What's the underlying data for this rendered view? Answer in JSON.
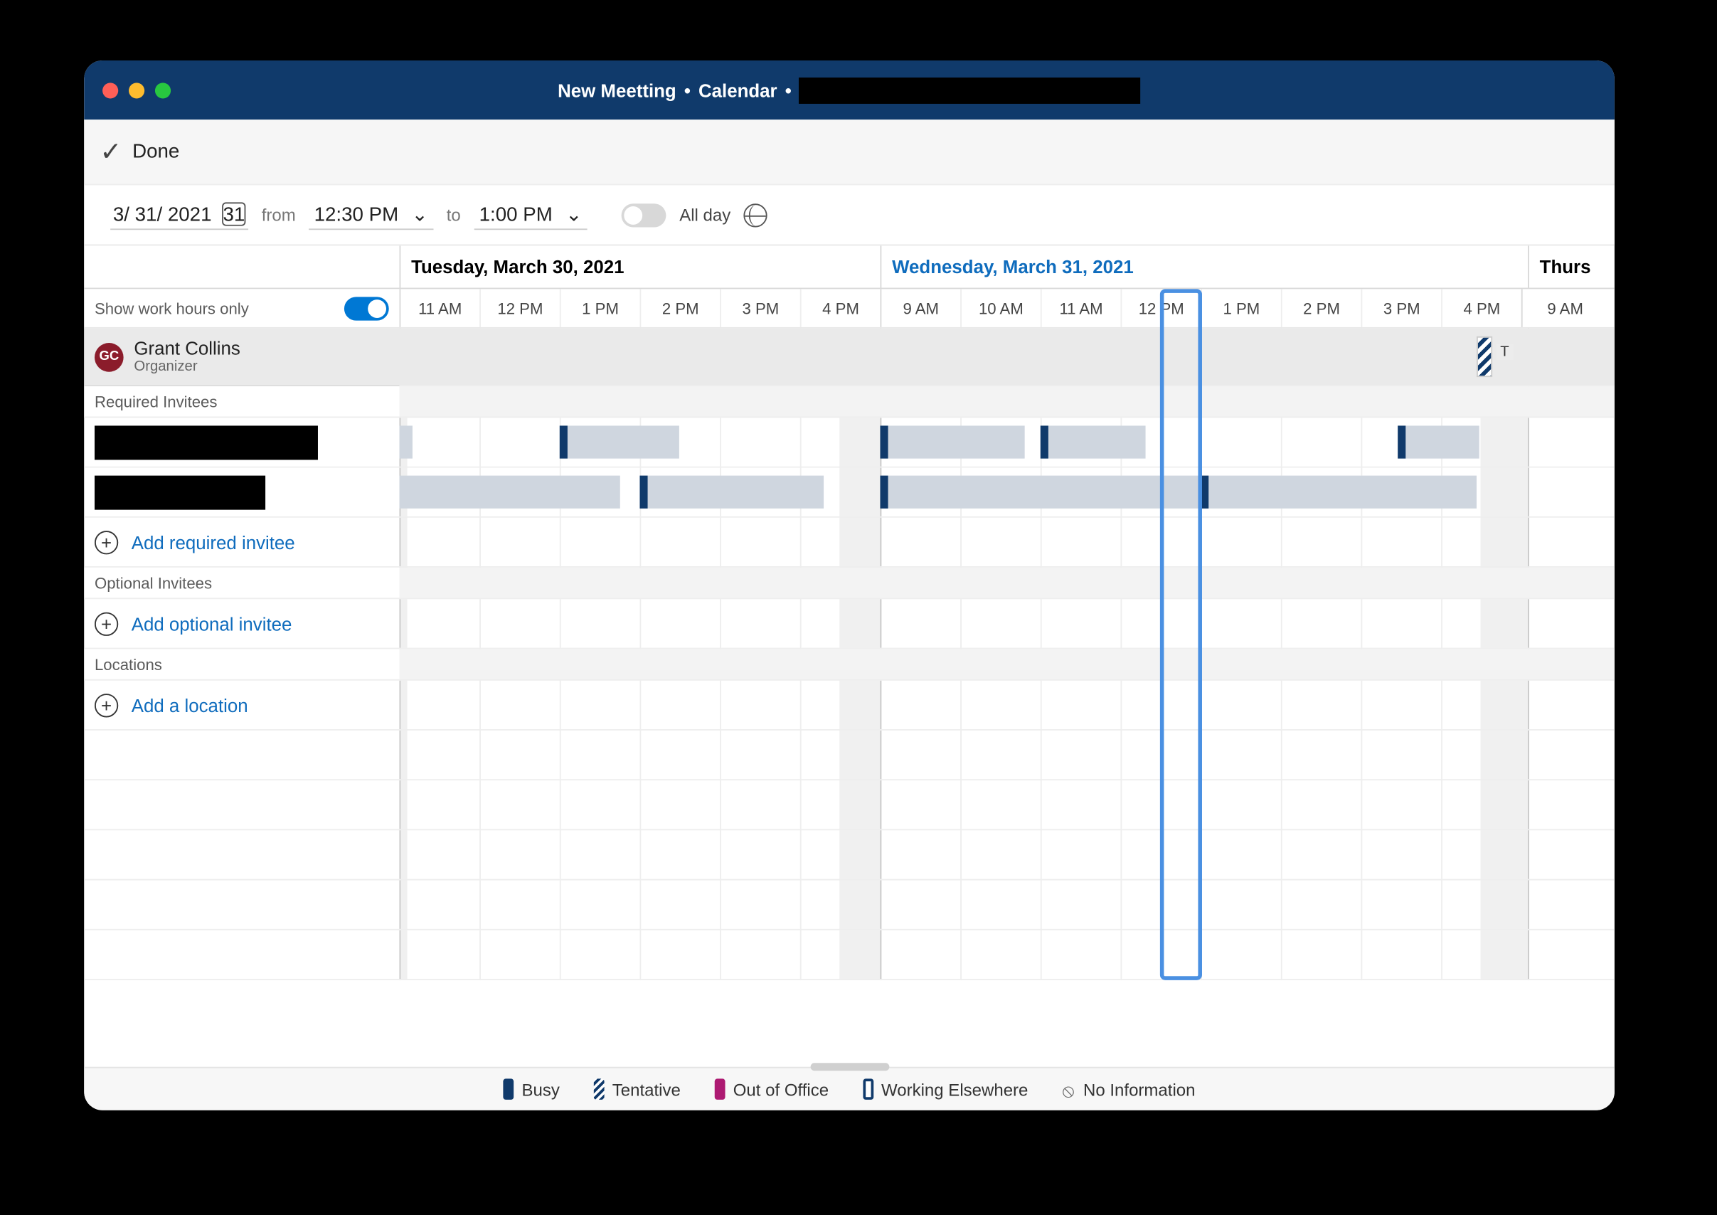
{
  "window": {
    "title_parts": [
      "New Meetting",
      "Calendar"
    ]
  },
  "toolbar": {
    "done_label": "Done"
  },
  "date_row": {
    "date": "3/ 31/ 2021",
    "cal_day": "31",
    "from_label": "from",
    "from_time": "12:30 PM",
    "to_label": "to",
    "to_time": "1:00 PM",
    "all_day_label": "All day"
  },
  "days": [
    {
      "label": "Tuesday, March 30, 2021",
      "today": false
    },
    {
      "label": "Wednesday, March 31, 2021",
      "today": true
    },
    {
      "label": "Thursday",
      "short": "Thurs",
      "today": false
    }
  ],
  "hours": [
    "11 AM",
    "12 PM",
    "1 PM",
    "2 PM",
    "3 PM",
    "4 PM",
    "9 AM",
    "10 AM",
    "11 AM",
    "12 PM",
    "1 PM",
    "2 PM",
    "3 PM",
    "4 PM",
    "9 AM"
  ],
  "left": {
    "work_hours_label": "Show work hours only",
    "work_hours_on": true,
    "organizer": {
      "initials": "GC",
      "name": "Grant Collins",
      "role": "Organizer"
    },
    "sections": {
      "required_h": "Required Invitees",
      "optional_h": "Optional Invitees",
      "locations_h": "Locations",
      "add_required": "Add required invitee",
      "add_optional": "Add optional invitee",
      "add_location": "Add a location"
    }
  },
  "legend": {
    "busy": "Busy",
    "tentative": "Tentative",
    "ooo": "Out of Office",
    "we": "Working Elsewhere",
    "na": "No Information"
  },
  "tentative_marker_letter": "T"
}
